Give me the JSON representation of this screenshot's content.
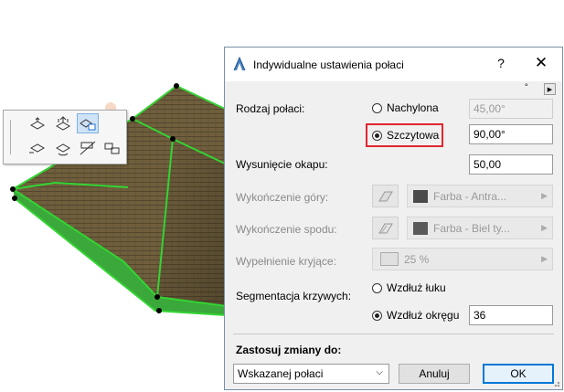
{
  "dialog": {
    "title": "Indywidualne ustawienia połaci",
    "help_label": "?",
    "close_label": "✕",
    "roof_type": {
      "label": "Rodzaj połaci:",
      "options": [
        {
          "label": "Nachylona",
          "value": "45,00°",
          "selected": false
        },
        {
          "label": "Szczytowa",
          "value": "90,00°",
          "selected": true
        }
      ]
    },
    "eaves_overhang": {
      "label": "Wysunięcie okapu:",
      "value": "50,00"
    },
    "top_finish": {
      "label": "Wykończenie góry:",
      "material": "Farba - Antra..."
    },
    "bottom_finish": {
      "label": "Wykończenie spodu:",
      "material": "Farba - Biel ty..."
    },
    "cover_fill": {
      "label": "Wypełnienie kryjące:",
      "value": "25 %"
    },
    "curve_segmentation": {
      "label": "Segmentacja krzywych:",
      "options": [
        {
          "label": "Wzdłuż łuku",
          "selected": false
        },
        {
          "label": "Wzdłuż okręgu",
          "selected": true,
          "value": "36"
        }
      ]
    },
    "apply_to": {
      "label": "Zastosuj zmiany do:",
      "selected": "Wskazanej połaci"
    },
    "cancel_label": "Anuluj",
    "ok_label": "OK",
    "mini_label": "°"
  },
  "colors": {
    "roof_green": "#2fbf2f",
    "roof_brown": "#6b5a3a",
    "highlight_red": "#e3262f",
    "ok_border": "#0078d7"
  }
}
